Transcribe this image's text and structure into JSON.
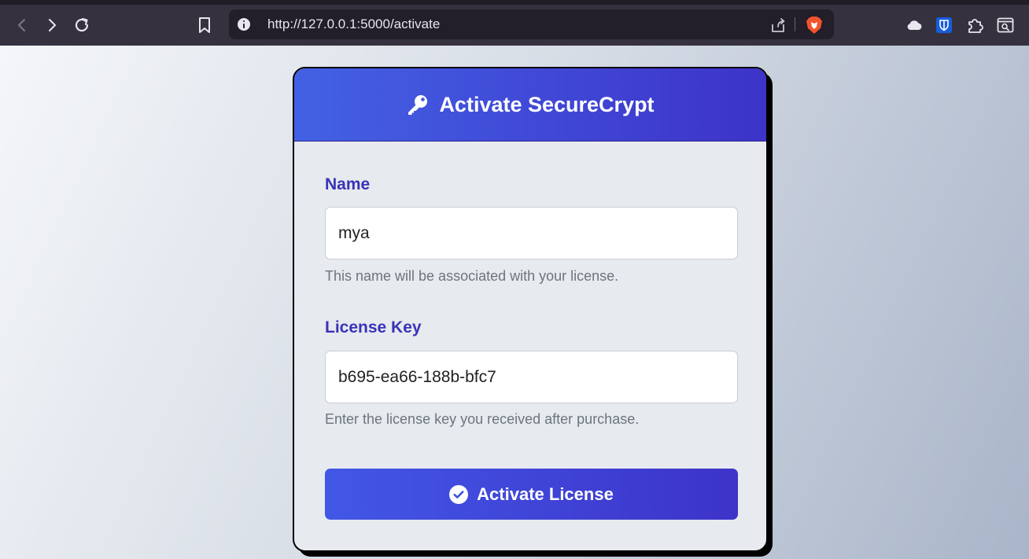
{
  "browser": {
    "url": "http://127.0.0.1:5000/activate",
    "icons": [
      "back-icon",
      "forward-icon",
      "reload-icon",
      "bookmark-icon",
      "site-info-icon",
      "share-icon",
      "brave-shield-icon",
      "cloud-icon",
      "bitwarden-icon",
      "extensions-icon",
      "reader-mode-icon"
    ]
  },
  "card": {
    "title": "Activate SecureCrypt",
    "header_icon": "key-icon",
    "accent_color": "#3d33c9"
  },
  "form": {
    "name": {
      "label": "Name",
      "value": "mya",
      "help": "This name will be associated with your license."
    },
    "license": {
      "label": "License Key",
      "value": "b695-ea66-188b-bfc7",
      "help": "Enter the license key you received after purchase."
    },
    "submit": {
      "label": "Activate License",
      "icon": "check-circle-icon"
    }
  }
}
